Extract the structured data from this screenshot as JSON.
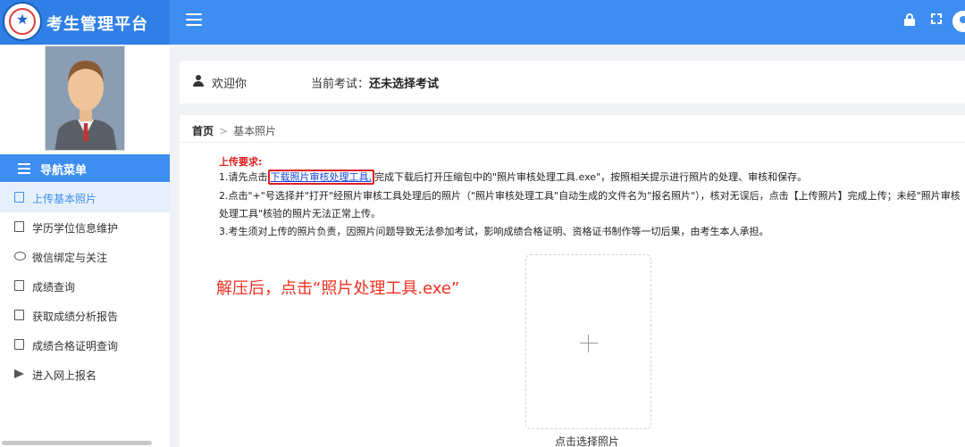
{
  "header": {
    "title": "考生管理平台",
    "icons": [
      "menu-icon",
      "lock-icon",
      "fullscreen-icon",
      "user-avatar-icon"
    ]
  },
  "sidebar": {
    "nav_title": "导航菜单",
    "items": [
      {
        "label": "上传基本照片",
        "icon": "image-icon",
        "active": true
      },
      {
        "label": "学历学位信息维护",
        "icon": "book-icon"
      },
      {
        "label": "微信绑定与关注",
        "icon": "chat-icon"
      },
      {
        "label": "成绩查询",
        "icon": "document-icon"
      },
      {
        "label": "获取成绩分析报告",
        "icon": "report-icon"
      },
      {
        "label": "成绩合格证明查询",
        "icon": "certificate-icon"
      },
      {
        "label": "进入网上报名",
        "icon": "send-icon"
      }
    ]
  },
  "welcome": {
    "greeting": "欢迎你",
    "exam_label": "当前考试：",
    "exam_value": "还未选择考试"
  },
  "breadcrumb": {
    "home": "首页",
    "current": "基本照片"
  },
  "requirements": {
    "title": "上传要求:",
    "line1_prefix": "1.请先点击",
    "line1_link": "下载照片审核处理工具,",
    "line1_suffix": "完成下载后打开压缩包中的\"照片审核处理工具.exe\"，按照相关提示进行照片的处理、审核和保存。",
    "line2a": "2.点击\"+\"号选择并\"打开\"经照片审核工具处理后的照片（\"照片审核处理工具\"自动生成的文件名为\"报名照片\"），核对无误后，点击【上传照片】完成上传；未经\"照片审核",
    "line2b": "处理工具\"核验的照片无法正常上传。",
    "line3": "3.考生须对上传的照片负责，因照片问题导致无法参加考试，影响成绩合格证明、资格证书制作等一切后果，由考生本人承担。"
  },
  "annotation": "解压后，点击“照片处理工具.exe”",
  "uploader": {
    "label": "点击选择照片"
  }
}
